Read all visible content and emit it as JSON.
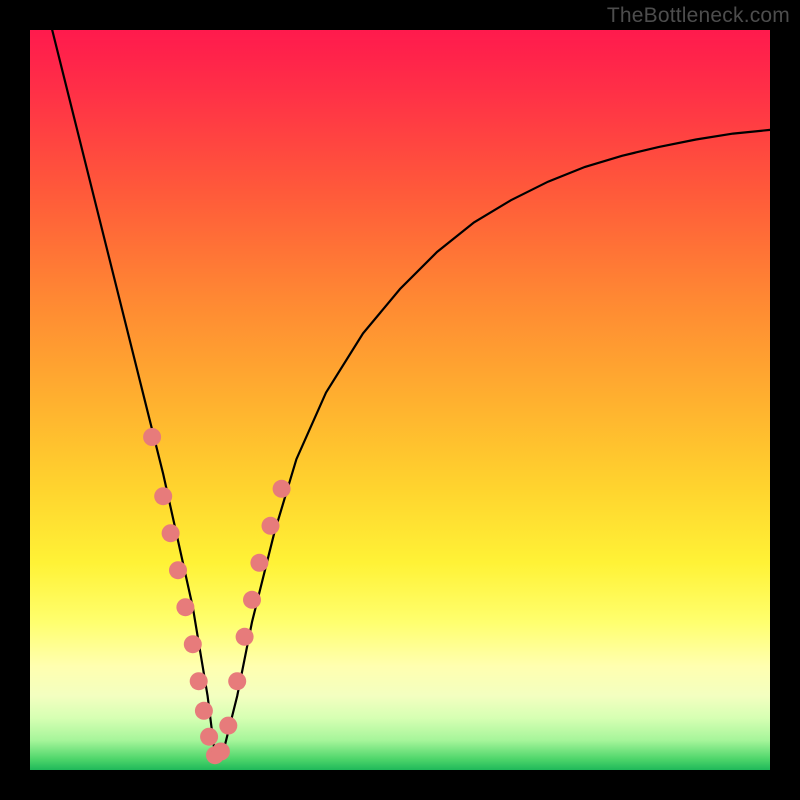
{
  "watermark": "TheBottleneck.com",
  "colors": {
    "frame": "#000000",
    "dot": "#e77b7b",
    "curve": "#000000"
  },
  "chart_data": {
    "type": "line",
    "title": "",
    "xlabel": "",
    "ylabel": "",
    "xlim": [
      0,
      100
    ],
    "ylim": [
      0,
      100
    ],
    "grid": false,
    "legend": false,
    "notes": "V-shaped curve, minimum near x≈25. Background vertical gradient from red (top, high bottleneck) through orange/yellow to green (bottom, low bottleneck). Pink dots highlight sample points near the minimum region.",
    "series": [
      {
        "name": "curve",
        "x": [
          3,
          6,
          9,
          12,
          15,
          18,
          20,
          22,
          24,
          25,
          26,
          28,
          30,
          33,
          36,
          40,
          45,
          50,
          55,
          60,
          65,
          70,
          75,
          80,
          85,
          90,
          95,
          100
        ],
        "y": [
          100,
          88,
          76,
          64,
          52,
          40,
          31,
          22,
          10,
          2,
          2,
          10,
          20,
          32,
          42,
          51,
          59,
          65,
          70,
          74,
          77,
          79.5,
          81.5,
          83,
          84.2,
          85.2,
          86,
          86.5
        ]
      }
    ],
    "highlight_points": {
      "name": "samples",
      "x": [
        16.5,
        18.0,
        19.0,
        20.0,
        21.0,
        22.0,
        22.8,
        23.5,
        24.2,
        25.0,
        25.8,
        26.8,
        28.0,
        29.0,
        30.0,
        31.0,
        32.5,
        34.0
      ],
      "y": [
        45.0,
        37.0,
        32.0,
        27.0,
        22.0,
        17.0,
        12.0,
        8.0,
        4.5,
        2.0,
        2.5,
        6.0,
        12.0,
        18.0,
        23.0,
        28.0,
        33.0,
        38.0
      ]
    }
  }
}
